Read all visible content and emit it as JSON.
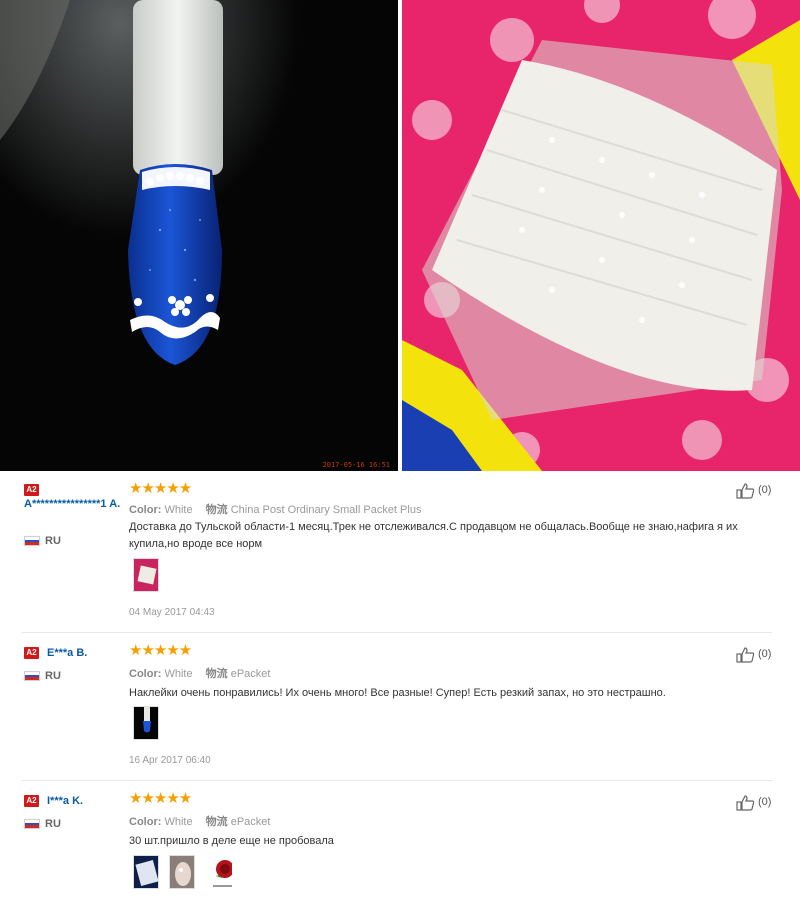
{
  "photo_timestamp": "2017-05-16 16:51",
  "reviews": [
    {
      "badge": "A2",
      "user": "A****************1 A.",
      "country": "RU",
      "rating": "★★★★★",
      "color_label": "Color:",
      "color_value": "White",
      "shipping_label": "物流",
      "shipping_value": "China Post Ordinary Small Packet Plus",
      "text": "Доставка до Тульской области-1 месяц.Трек не отслеживался.С продавцом не общалась.Вообще не знаю,нафига я их купила,но вроде все норм",
      "date": "04 May 2017 04:43",
      "likes": "(0)"
    },
    {
      "badge": "A2",
      "user": "E***a B.",
      "country": "RU",
      "rating": "★★★★★",
      "color_label": "Color:",
      "color_value": "White",
      "shipping_label": "物流",
      "shipping_value": "ePacket",
      "text": "Наклейки очень понравились! Их очень много! Все разные! Супер! Есть резкий запах, но это нестрашно.",
      "date": "16 Apr 2017 06:40",
      "likes": "(0)"
    },
    {
      "badge": "A2",
      "user": "I***a K.",
      "country": "RU",
      "rating": "★★★★★",
      "color_label": "Color:",
      "color_value": "White",
      "shipping_label": "物流",
      "shipping_value": "ePacket",
      "text": "30 шт.пришло в деле еще не пробовала",
      "likes": "(0)"
    }
  ],
  "colors": {
    "user_link": "#0b5aa6",
    "star": "#f5a000",
    "badge": "#d1181b"
  },
  "icons": [
    "thumbs-up-icon",
    "star-icon",
    "russia-flag-icon"
  ]
}
